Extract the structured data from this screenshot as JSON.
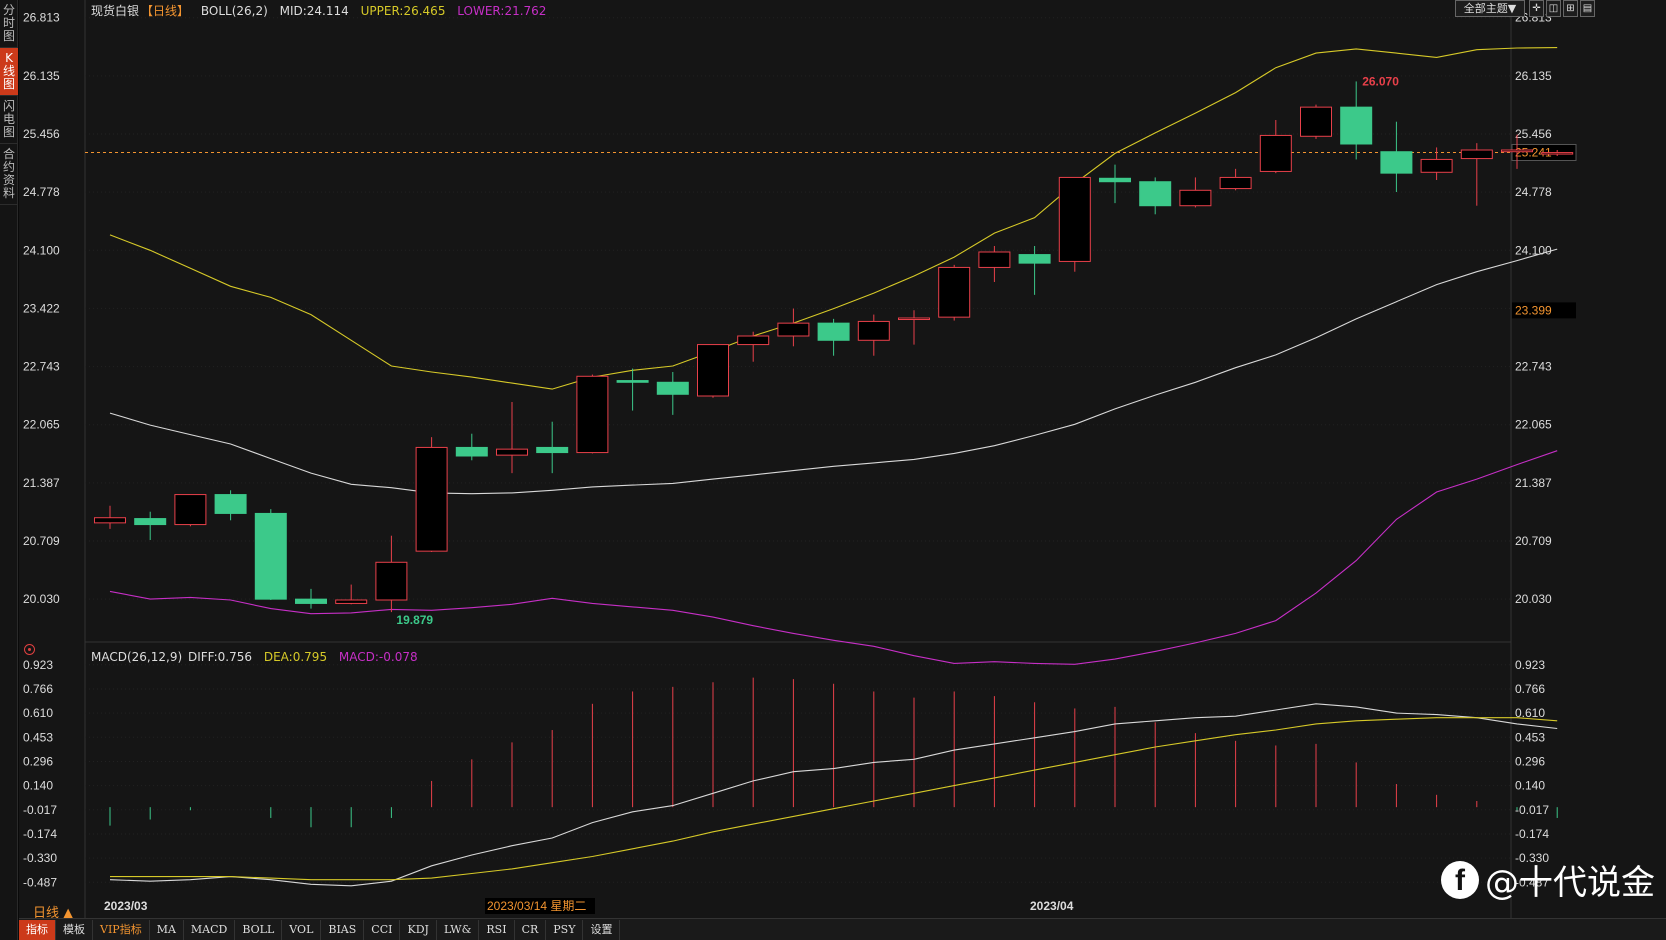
{
  "side_tabs": [
    {
      "label": "分时图",
      "active": false
    },
    {
      "label": "K线图",
      "active": true
    },
    {
      "label": "闪电图",
      "active": false
    },
    {
      "label": "合约资料",
      "active": false
    }
  ],
  "boll_info": {
    "name": "现货白银",
    "period": "【日线】",
    "indicator": "BOLL(26,2)",
    "mid": "MID:24.114",
    "upper": "UPPER:26.465",
    "lower": "LOWER:21.762"
  },
  "macd_info": {
    "indicator": "MACD(26,12,9)",
    "diff": "DIFF:0.756",
    "dea": "DEA:0.795",
    "macd": "MACD:-0.078"
  },
  "toolbar": {
    "theme": "全部主题▼",
    "btn1": "✛",
    "btn2": "◫",
    "btn3": "⊞",
    "btn4": "▤"
  },
  "price_ticks": [
    "26.813",
    "26.135",
    "25.456",
    "24.778",
    "24.100",
    "23.422",
    "22.743",
    "22.065",
    "21.387",
    "20.709",
    "20.030"
  ],
  "macd_ticks": [
    "0.923",
    "0.766",
    "0.610",
    "0.453",
    "0.296",
    "0.140",
    "-0.017",
    "-0.174",
    "-0.330",
    "-0.487"
  ],
  "current_price": "25.241",
  "crosshair_price": "23.399",
  "high_label": "26.070",
  "low_label": "19.879",
  "date_labels": {
    "start": "2023/03",
    "mid": "2023/04",
    "cursor": "2023/03/14 星期二"
  },
  "period_selector": "日线 ▲",
  "bottom_tabs": [
    "指标",
    "模板",
    "VIP指标",
    "MA",
    "MACD",
    "BOLL",
    "VOL",
    "BIAS",
    "CCI",
    "KDJ",
    "LW&",
    "RSI",
    "CR",
    "PSY",
    "设置"
  ],
  "watermark": "@十代说金",
  "colors": {
    "up": "#e8404a",
    "down": "#3cc98a",
    "mid": "#d8d8d8",
    "upper": "#d6c928",
    "lower": "#c62fc6",
    "accent": "#f29430"
  },
  "chart_data": {
    "type": "candlestick",
    "candles": [
      {
        "o": 20.92,
        "h": 21.12,
        "l": 20.85,
        "c": 20.98
      },
      {
        "o": 20.97,
        "h": 21.05,
        "l": 20.72,
        "c": 20.9
      },
      {
        "o": 20.9,
        "h": 21.23,
        "l": 20.88,
        "c": 21.25
      },
      {
        "o": 21.25,
        "h": 21.3,
        "l": 20.95,
        "c": 21.03
      },
      {
        "o": 21.03,
        "h": 21.08,
        "l": 20.02,
        "c": 20.03
      },
      {
        "o": 20.03,
        "h": 20.15,
        "l": 19.92,
        "c": 19.98
      },
      {
        "o": 19.98,
        "h": 20.2,
        "l": 19.97,
        "c": 20.02
      },
      {
        "o": 20.02,
        "h": 20.77,
        "l": 19.879,
        "c": 20.46
      },
      {
        "o": 20.59,
        "h": 21.92,
        "l": 20.58,
        "c": 21.8
      },
      {
        "o": 21.8,
        "h": 21.96,
        "l": 21.65,
        "c": 21.7
      },
      {
        "o": 21.71,
        "h": 22.33,
        "l": 21.5,
        "c": 21.78
      },
      {
        "o": 21.8,
        "h": 22.1,
        "l": 21.5,
        "c": 21.74
      },
      {
        "o": 21.74,
        "h": 22.65,
        "l": 21.73,
        "c": 22.63
      },
      {
        "o": 22.58,
        "h": 22.72,
        "l": 22.23,
        "c": 22.56
      },
      {
        "o": 22.56,
        "h": 22.68,
        "l": 22.18,
        "c": 22.42
      },
      {
        "o": 22.4,
        "h": 23.0,
        "l": 22.38,
        "c": 23.0
      },
      {
        "o": 23.0,
        "h": 23.15,
        "l": 22.8,
        "c": 23.1
      },
      {
        "o": 23.1,
        "h": 23.42,
        "l": 22.98,
        "c": 23.25
      },
      {
        "o": 23.25,
        "h": 23.3,
        "l": 22.87,
        "c": 23.05
      },
      {
        "o": 23.05,
        "h": 23.35,
        "l": 22.87,
        "c": 23.27
      },
      {
        "o": 23.3,
        "h": 23.4,
        "l": 23.0,
        "c": 23.31
      },
      {
        "o": 23.32,
        "h": 23.93,
        "l": 23.28,
        "c": 23.9
      },
      {
        "o": 23.9,
        "h": 24.15,
        "l": 23.73,
        "c": 24.08
      },
      {
        "o": 24.05,
        "h": 24.15,
        "l": 23.58,
        "c": 23.95
      },
      {
        "o": 23.97,
        "h": 24.9,
        "l": 23.85,
        "c": 24.95
      },
      {
        "o": 24.94,
        "h": 25.1,
        "l": 24.65,
        "c": 24.9
      },
      {
        "o": 24.9,
        "h": 24.95,
        "l": 24.52,
        "c": 24.62
      },
      {
        "o": 24.62,
        "h": 24.95,
        "l": 24.6,
        "c": 24.8
      },
      {
        "o": 24.82,
        "h": 25.05,
        "l": 24.8,
        "c": 24.95
      },
      {
        "o": 25.02,
        "h": 25.62,
        "l": 25.0,
        "c": 25.44
      },
      {
        "o": 25.43,
        "h": 25.8,
        "l": 25.4,
        "c": 25.77
      },
      {
        "o": 25.77,
        "h": 26.07,
        "l": 25.16,
        "c": 25.34
      },
      {
        "o": 25.25,
        "h": 25.6,
        "l": 24.78,
        "c": 25.0
      },
      {
        "o": 25.01,
        "h": 25.3,
        "l": 24.92,
        "c": 25.16
      },
      {
        "o": 25.17,
        "h": 25.35,
        "l": 24.62,
        "c": 25.27
      },
      {
        "o": 25.25,
        "h": 25.45,
        "l": 25.05,
        "c": 25.27
      },
      {
        "o": 25.24,
        "h": 25.27,
        "l": 25.2,
        "c": 25.24
      }
    ],
    "boll_mid": [
      22.2,
      22.06,
      21.95,
      21.84,
      21.67,
      21.5,
      21.37,
      21.33,
      21.27,
      21.26,
      21.27,
      21.3,
      21.34,
      21.36,
      21.38,
      21.43,
      21.48,
      21.53,
      21.58,
      21.62,
      21.66,
      21.73,
      21.82,
      21.94,
      22.07,
      22.25,
      22.41,
      22.56,
      22.73,
      22.88,
      23.08,
      23.3,
      23.5,
      23.7,
      23.85,
      23.98,
      24.114
    ],
    "boll_upper": [
      24.28,
      24.1,
      23.89,
      23.68,
      23.55,
      23.35,
      23.05,
      22.75,
      22.68,
      22.62,
      22.55,
      22.48,
      22.62,
      22.7,
      22.75,
      22.92,
      23.1,
      23.25,
      23.42,
      23.6,
      23.8,
      24.02,
      24.3,
      24.48,
      24.88,
      25.23,
      25.47,
      25.7,
      25.94,
      26.23,
      26.4,
      26.45,
      26.4,
      26.35,
      26.44,
      26.46,
      26.465
    ],
    "boll_lower": [
      20.12,
      20.03,
      20.05,
      20.02,
      19.92,
      19.86,
      19.87,
      19.91,
      19.9,
      19.93,
      19.97,
      20.04,
      19.98,
      19.94,
      19.9,
      19.82,
      19.72,
      19.63,
      19.55,
      19.48,
      19.37,
      19.28,
      19.3,
      19.28,
      19.27,
      19.33,
      19.42,
      19.52,
      19.63,
      19.78,
      20.1,
      20.48,
      20.96,
      21.28,
      21.43,
      21.6,
      21.762
    ],
    "diff": [
      -0.47,
      -0.48,
      -0.47,
      -0.45,
      -0.47,
      -0.5,
      -0.51,
      -0.48,
      -0.38,
      -0.31,
      -0.25,
      -0.2,
      -0.1,
      -0.03,
      0.01,
      0.09,
      0.17,
      0.23,
      0.25,
      0.29,
      0.31,
      0.37,
      0.41,
      0.45,
      0.49,
      0.54,
      0.56,
      0.58,
      0.59,
      0.63,
      0.67,
      0.65,
      0.61,
      0.6,
      0.58,
      0.54,
      0.51
    ],
    "dea": [
      -0.45,
      -0.45,
      -0.45,
      -0.45,
      -0.46,
      -0.47,
      -0.47,
      -0.47,
      -0.46,
      -0.43,
      -0.4,
      -0.36,
      -0.32,
      -0.27,
      -0.22,
      -0.16,
      -0.11,
      -0.06,
      -0.01,
      0.04,
      0.09,
      0.14,
      0.19,
      0.24,
      0.29,
      0.34,
      0.39,
      0.43,
      0.47,
      0.5,
      0.54,
      0.56,
      0.57,
      0.58,
      0.58,
      0.58,
      0.56
    ],
    "macd_hist": [
      -0.12,
      -0.08,
      -0.02,
      0.0,
      -0.07,
      -0.13,
      -0.13,
      -0.07,
      0.17,
      0.31,
      0.42,
      0.5,
      0.67,
      0.75,
      0.78,
      0.81,
      0.84,
      0.83,
      0.8,
      0.75,
      0.71,
      0.75,
      0.72,
      0.68,
      0.64,
      0.65,
      0.55,
      0.48,
      0.43,
      0.4,
      0.41,
      0.29,
      0.15,
      0.08,
      0.04,
      -0.02,
      -0.07
    ],
    "price_range": [
      19.6,
      26.95
    ],
    "macd_range": [
      -0.55,
      0.98
    ]
  }
}
